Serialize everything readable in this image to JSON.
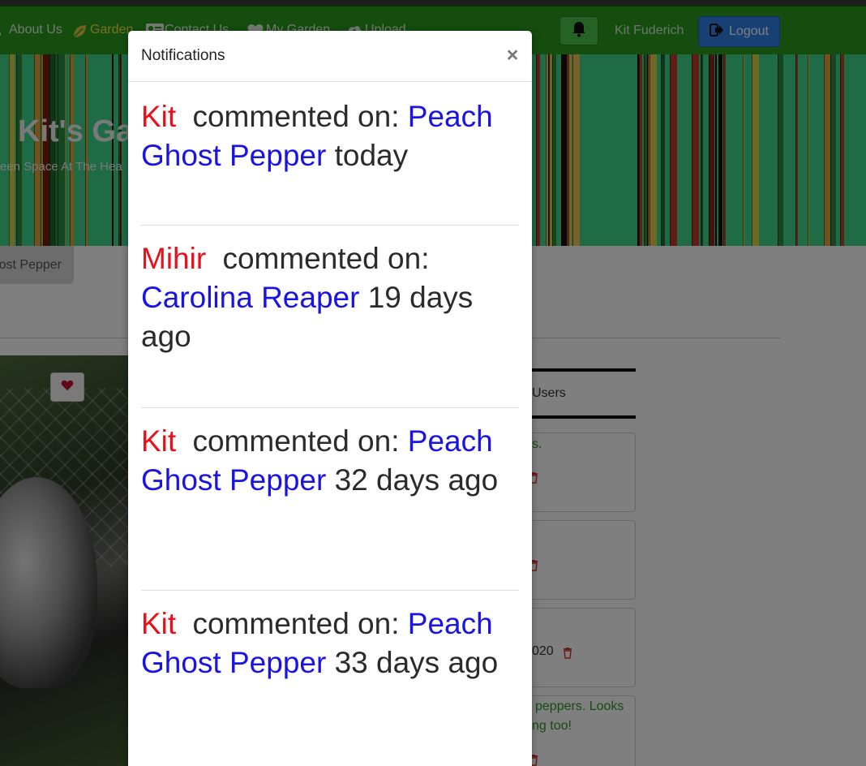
{
  "navbar": {
    "links": [
      {
        "label": "About Us",
        "icon": "about-icon",
        "active": false
      },
      {
        "label": "Garden",
        "icon": "leaf-icon",
        "active": true
      },
      {
        "label": "Contact Us",
        "icon": "contact-card-icon",
        "active": false
      },
      {
        "label": "My Garden",
        "icon": "heart-icon",
        "active": false
      },
      {
        "label": "Upload",
        "icon": "cloud-upload-icon",
        "active": false
      }
    ],
    "user_name": "Kit Fuderich",
    "logout_label": "Logout",
    "colors": {
      "bar": "#2a9a1e",
      "active_link": "#f3e34a",
      "logout": "#2f80e8",
      "bell": "#4cc24c"
    }
  },
  "banner": {
    "title": "Kit's Ga",
    "subtitle": "een Space At The Hea"
  },
  "page": {
    "plant_tab_label": "ost Pepper",
    "users_tab_label": "Users",
    "comments": [
      {
        "text": "s.",
        "date": ""
      },
      {
        "text": "",
        "date": ""
      },
      {
        "text": "",
        "date": "020"
      },
      {
        "text": "peppers. Looks",
        "text2": "ng too!",
        "date": ""
      }
    ]
  },
  "modal": {
    "title": "Notifications",
    "close_label": "×",
    "notifications": [
      {
        "user": "Kit",
        "action": "commented on:",
        "plant": "Peach Ghost Pepper",
        "when": "today"
      },
      {
        "user": "Mihir",
        "action": "commented on:",
        "plant": "Carolina Reaper",
        "when": "19 days ago"
      },
      {
        "user": "Kit",
        "action": "commented on:",
        "plant": "Peach Ghost Pepper",
        "when": "32 days ago"
      },
      {
        "user": "Kit",
        "action": "commented on:",
        "plant": "Peach Ghost Pepper",
        "when": "33 days ago"
      }
    ],
    "colors": {
      "user": "#e8101a",
      "plant": "#1a13e6"
    }
  }
}
